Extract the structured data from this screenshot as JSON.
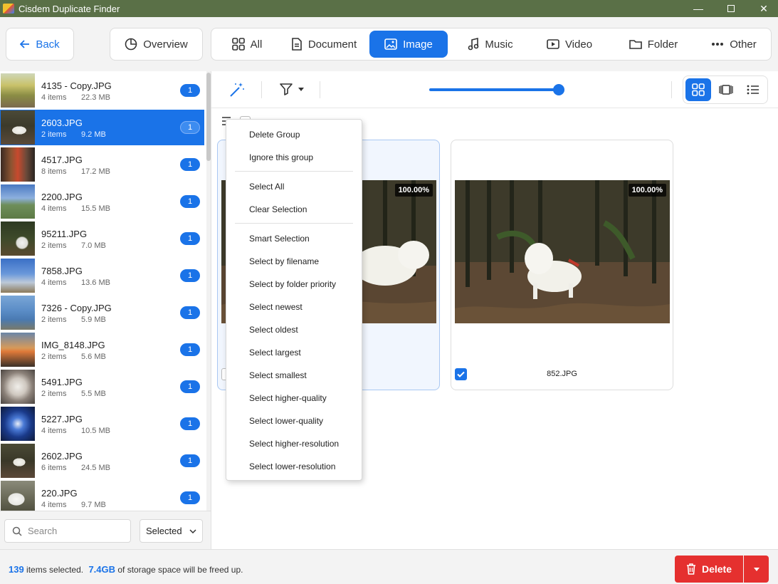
{
  "app": {
    "title": "Cisdem Duplicate Finder"
  },
  "topbar": {
    "back_label": "Back",
    "overview_label": "Overview",
    "tabs": [
      {
        "label": "All",
        "icon": "grid-icon"
      },
      {
        "label": "Document",
        "icon": "document-icon"
      },
      {
        "label": "Image",
        "icon": "image-icon",
        "active": true
      },
      {
        "label": "Music",
        "icon": "music-icon"
      },
      {
        "label": "Video",
        "icon": "video-icon"
      },
      {
        "label": "Folder",
        "icon": "folder-icon"
      },
      {
        "label": "Other",
        "icon": "more-icon"
      }
    ]
  },
  "sidebar": {
    "groups": [
      {
        "name": "4135 - Copy.JPG",
        "items": "4 items",
        "size": "22.3 MB",
        "count": "1",
        "thumb": "a"
      },
      {
        "name": "2603.JPG",
        "items": "2 items",
        "size": "9.2 MB",
        "count": "1",
        "selected": true,
        "thumb": "b"
      },
      {
        "name": "4517.JPG",
        "items": "8 items",
        "size": "17.2 MB",
        "count": "1",
        "thumb": "c"
      },
      {
        "name": "2200.JPG",
        "items": "4 items",
        "size": "15.5 MB",
        "count": "1",
        "thumb": "d"
      },
      {
        "name": "95211.JPG",
        "items": "2 items",
        "size": "7.0 MB",
        "count": "1",
        "thumb": "e"
      },
      {
        "name": "7858.JPG",
        "items": "4 items",
        "size": "13.6 MB",
        "count": "1",
        "thumb": "f"
      },
      {
        "name": "7326 - Copy.JPG",
        "items": "2 items",
        "size": "5.9 MB",
        "count": "1",
        "thumb": "g"
      },
      {
        "name": "IMG_8148.JPG",
        "items": "2 items",
        "size": "5.6 MB",
        "count": "1",
        "thumb": "h"
      },
      {
        "name": "5491.JPG",
        "items": "2 items",
        "size": "5.5 MB",
        "count": "1",
        "thumb": "i"
      },
      {
        "name": "5227.JPG",
        "items": "4 items",
        "size": "10.5 MB",
        "count": "1",
        "thumb": "j"
      },
      {
        "name": "2602.JPG",
        "items": "6 items",
        "size": "24.5 MB",
        "count": "1",
        "thumb": "k"
      },
      {
        "name": "220.JPG",
        "items": "4 items",
        "size": "9.7 MB",
        "count": "1",
        "thumb": "l"
      }
    ],
    "search_placeholder": "Search",
    "filter_value": "Selected"
  },
  "cards": [
    {
      "match": "100.00%",
      "filename": "2603.JPG",
      "checked": false
    },
    {
      "match": "100.00%",
      "filename": "852.JPG",
      "checked": true
    }
  ],
  "context_menu": {
    "items": [
      "Delete Group",
      "Ignore this group",
      "Select All",
      "Clear Selection",
      "Smart Selection",
      "Select by filename",
      "Select by folder priority",
      "Select newest",
      "Select oldest",
      "Select largest",
      "Select smallest",
      "Select higher-quality",
      "Select lower-quality",
      "Select higher-resolution",
      "Select lower-resolution"
    ]
  },
  "footer": {
    "count": "139",
    "count_suffix": "items selected.",
    "size": "7.4GB",
    "size_suffix": "of storage space will be freed up.",
    "delete_label": "Delete"
  },
  "colors": {
    "accent": "#1a73e8",
    "titlebar": "#5a7047",
    "danger": "#e5302f"
  }
}
